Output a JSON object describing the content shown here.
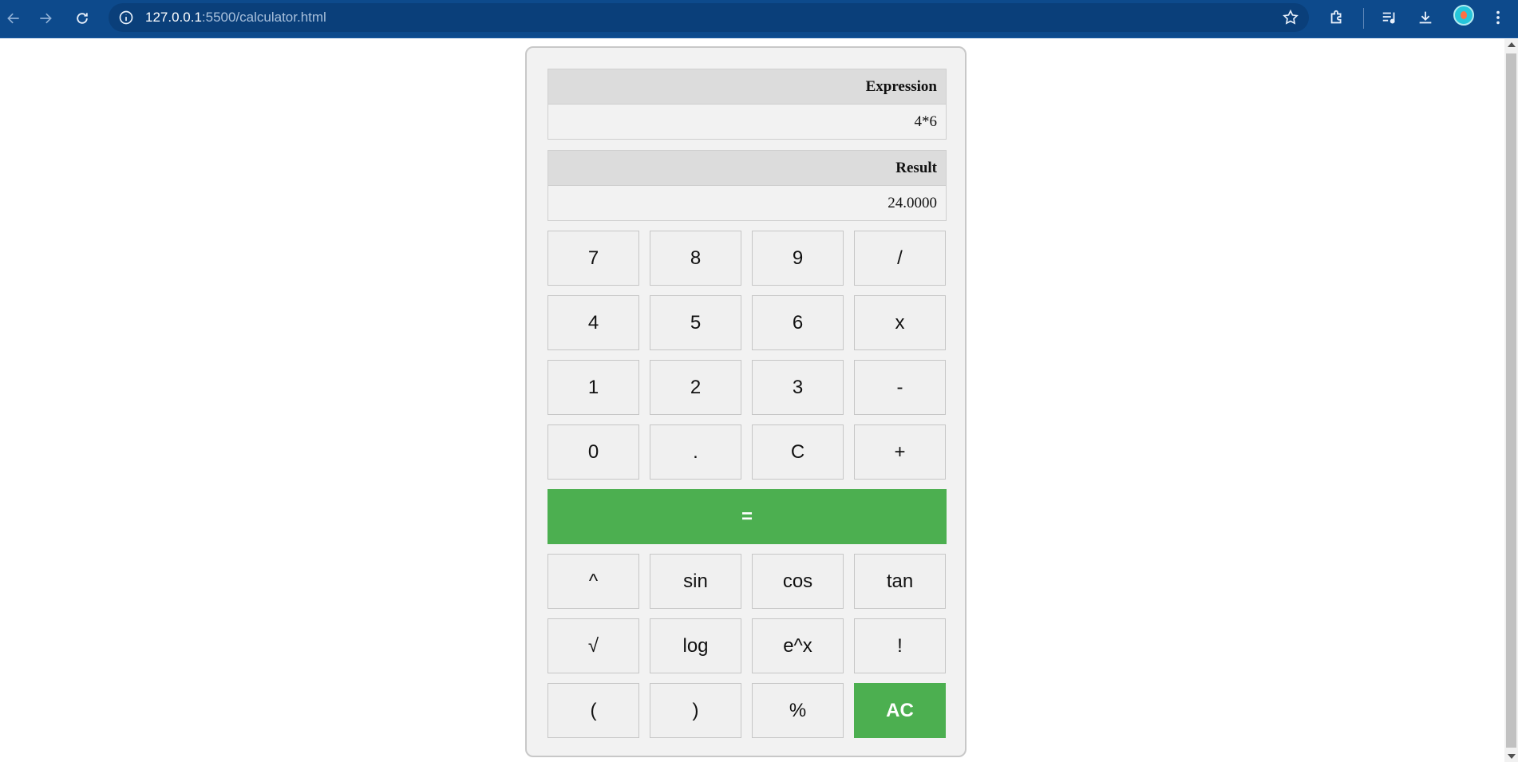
{
  "browser": {
    "url_host": "127.0.0.1",
    "url_path": ":5500/calculator.html"
  },
  "display": {
    "expression_header": "Expression",
    "expression_value": "4*6",
    "result_header": "Result",
    "result_value": "24.0000"
  },
  "buttons": {
    "seven": "7",
    "eight": "8",
    "nine": "9",
    "divide": "/",
    "four": "4",
    "five": "5",
    "six": "6",
    "multiply": "x",
    "one": "1",
    "two": "2",
    "three": "3",
    "minus": "-",
    "zero": "0",
    "dot": ".",
    "clear": "C",
    "plus": "+",
    "equals": "=",
    "power": "^",
    "sin": "sin",
    "cos": "cos",
    "tan": "tan",
    "sqrt": "√",
    "log": "log",
    "exp": "e^x",
    "factorial": "!",
    "open_paren": "(",
    "close_paren": ")",
    "percent": "%",
    "all_clear": "AC"
  },
  "colors": {
    "chrome": "#0d4a8c",
    "accent_green": "#4caf50"
  }
}
